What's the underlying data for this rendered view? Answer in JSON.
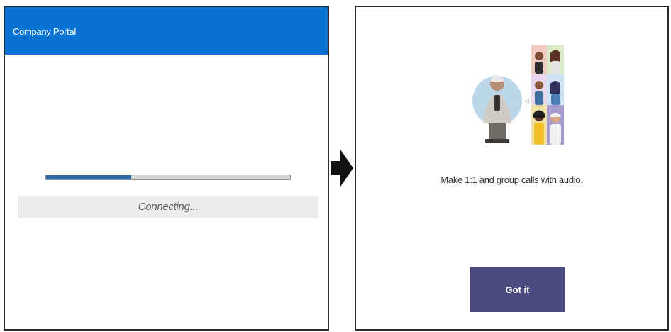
{
  "colors": {
    "brand": "#0a73d2",
    "progress": "#2f6aa8",
    "button": "#4b4a7d"
  },
  "left_panel": {
    "app_title": "Company Portal",
    "progress": 0.35,
    "status_text": "Connecting..."
  },
  "arrow": {
    "icon": "right-arrow-icon"
  },
  "right_panel": {
    "illustration": "group-call-illustration",
    "message": "Make 1:1 and group calls with audio.",
    "button_label": "Got it"
  }
}
